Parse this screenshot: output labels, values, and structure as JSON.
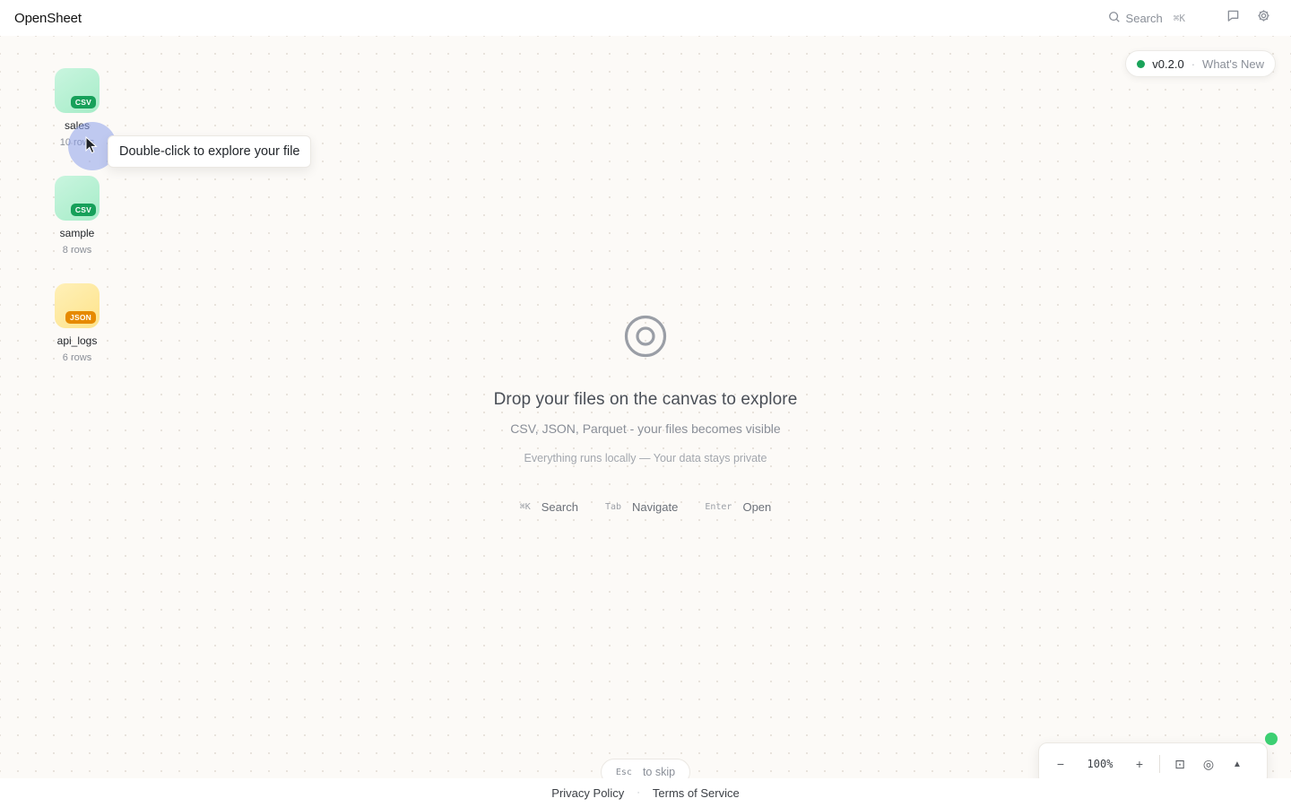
{
  "app": {
    "title": "OpenSheet"
  },
  "topbar": {
    "search_label": "Search",
    "search_shortcut": "⌘K",
    "icons": [
      "search-icon",
      "comment-icon",
      "gear-icon"
    ]
  },
  "version": {
    "label": "v0.2.0",
    "separator": "·",
    "whats_new": "What's New",
    "status_color": "#1aa35a"
  },
  "files": [
    {
      "name": "sales",
      "rows": "10 rows",
      "type": "CSV"
    },
    {
      "name": "sample",
      "rows": "8 rows",
      "type": "CSV"
    },
    {
      "name": "api_logs",
      "rows": "6 rows",
      "type": "JSON"
    }
  ],
  "tooltip": {
    "text": "Double-click to explore your file"
  },
  "empty_state": {
    "headline": "Drop your files on the canvas to explore",
    "subline": "CSV, JSON, Parquet - your files becomes visible",
    "privacy": "Everything runs locally — Your data stays private",
    "shortcuts": [
      {
        "key": "⌘K",
        "label": "Search"
      },
      {
        "key": "Tab",
        "label": "Navigate"
      },
      {
        "key": "Enter",
        "label": "Open"
      }
    ]
  },
  "skip": {
    "key": "Esc",
    "label": "to skip"
  },
  "zoom": {
    "minus": "−",
    "value": "100%",
    "plus": "+",
    "fit": "⊡",
    "center": "◎",
    "up": "▲"
  },
  "footer": {
    "privacy": "Privacy Policy",
    "separator": "·",
    "terms": "Terms of Service"
  },
  "colors": {
    "csv_badge": "#17a05a",
    "json_badge": "#e68a00",
    "online": "#3ccf72"
  }
}
